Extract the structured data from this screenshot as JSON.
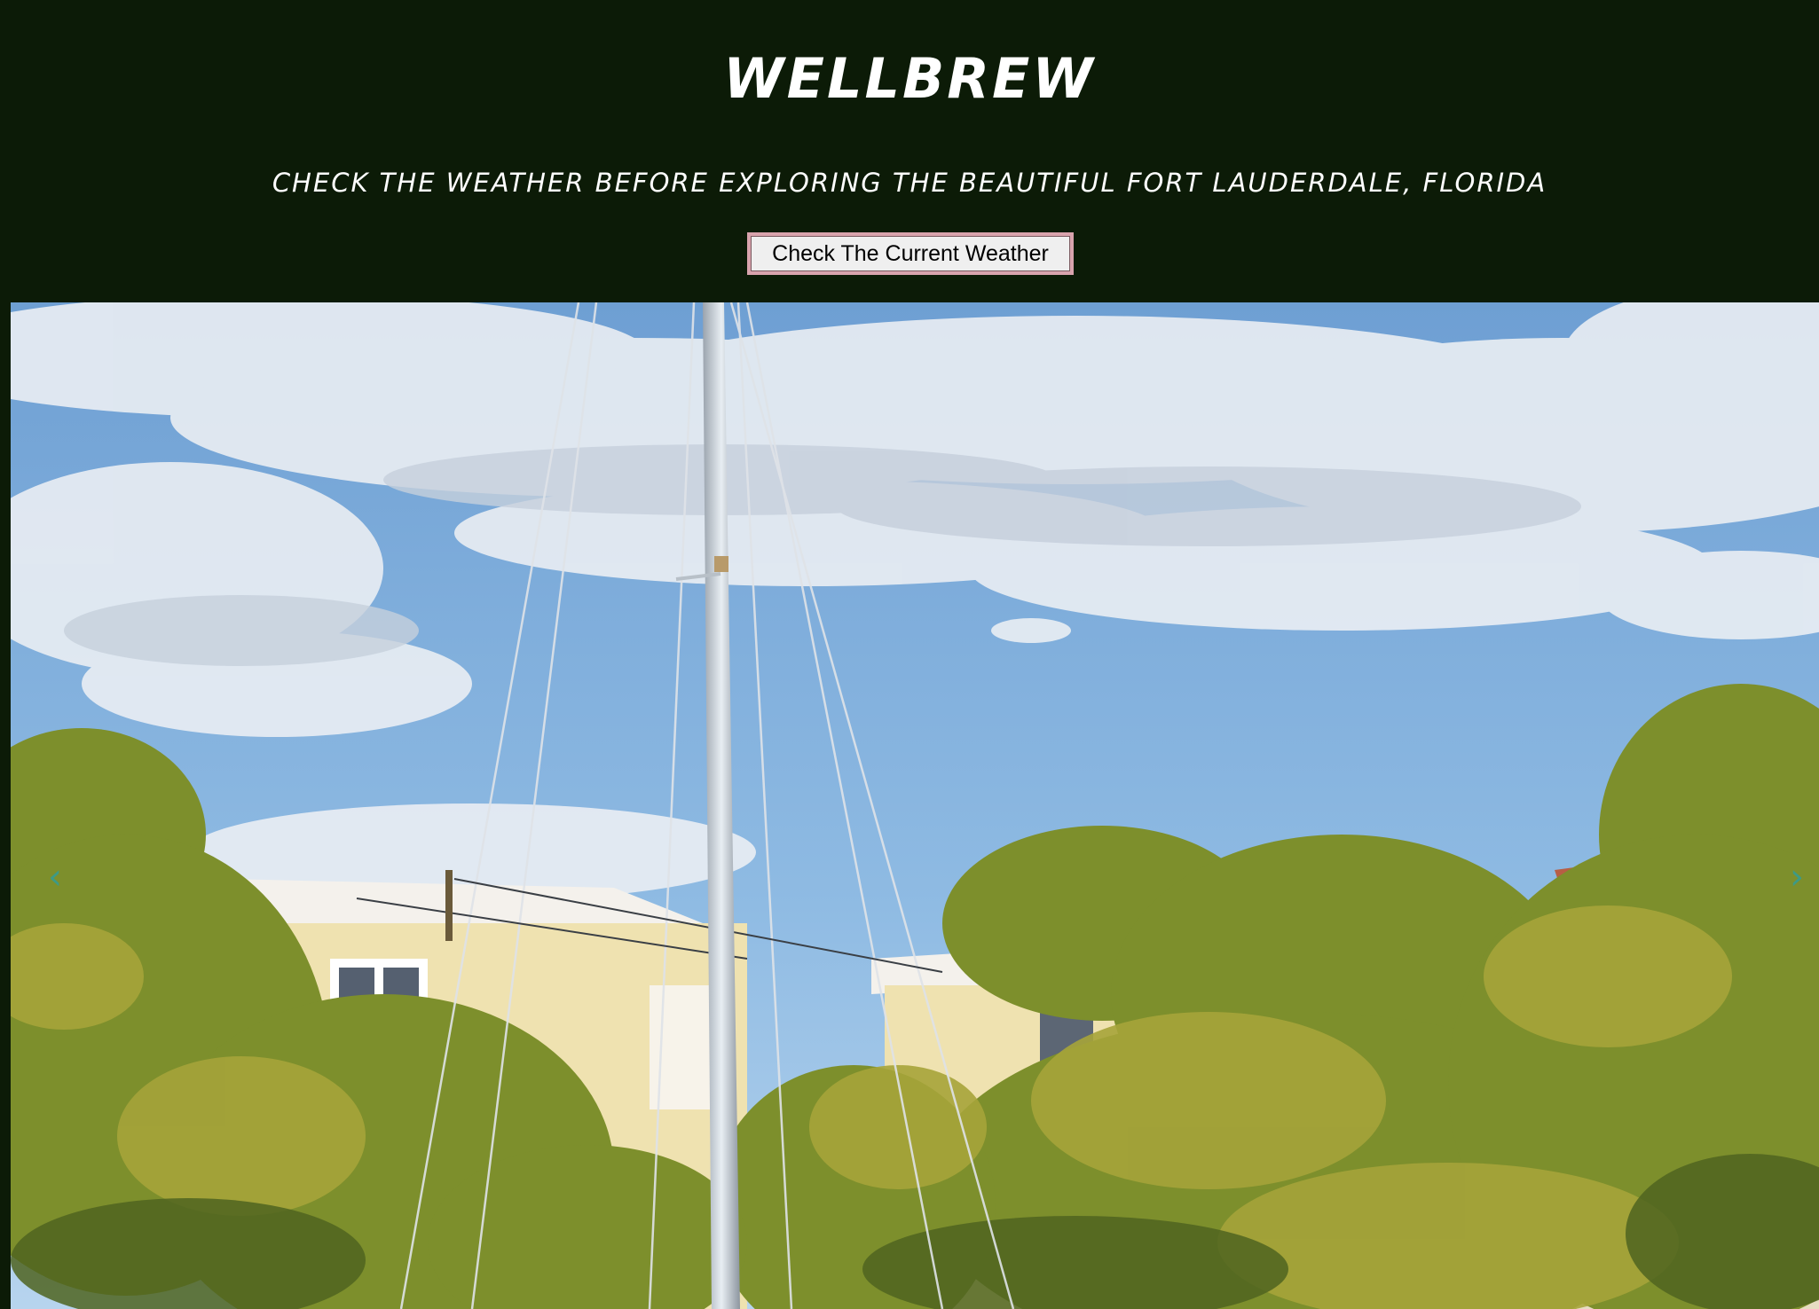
{
  "header": {
    "title": "WELLBREW",
    "tagline": "CHECK THE WEATHER BEFORE EXPLORING THE BEAUTIFUL FORT LAUDERDALE, FLORIDA",
    "button_label": "Check The Current Weather"
  },
  "carousel": {
    "prev_icon": "chevron-left-icon",
    "prev_glyph": "‹",
    "next_icon": "chevron-right-icon",
    "next_glyph": "›"
  },
  "colors": {
    "header_background": "#0c1b07",
    "button_border": "#d9a3ad",
    "arrow": "#3d9a86"
  }
}
